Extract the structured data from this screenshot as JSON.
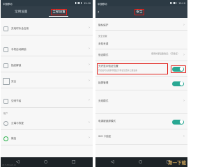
{
  "left": {
    "status": {
      "carrier": "中国移动",
      "time": "15:10"
    },
    "tabs": {
      "common": "常用设置",
      "all": "全部设置"
    },
    "rows": [
      {
        "label": "充电时补全应用"
      },
      {
        "label": "手机自动解锁"
      },
      {
        "label": "指纹解锁"
      },
      {
        "label": "安全"
      },
      {
        "label": "空闲节省"
      }
    ],
    "section": "帐户",
    "account_rows": [
      {
        "label": "云端与恢复"
      },
      {
        "label": "微信"
      }
    ],
    "credit": "@: 5.fm.sm.cn"
  },
  "right": {
    "status": {
      "carrier": "中国移动",
      "time": "15:10"
    },
    "title": "安全",
    "rows": [
      {
        "label": "隐私保护"
      },
      {
        "label": "未知来源"
      },
      {
        "label": "验证模式",
        "value": "使用外部设备验证：（已验证）"
      },
      {
        "label": "允许显示验证位置",
        "sub": "开启后可在锁屏界面显示验证位置并上报设备"
      },
      {
        "label": "锁屏管理"
      },
      {
        "label": "无线模式"
      },
      {
        "label": "电源键锁屏模式"
      },
      {
        "label": "SIM 卡锁定"
      }
    ],
    "toggle_states": [
      true,
      true,
      true
    ],
    "section": "安全设置",
    "watermark": "第一下载"
  },
  "icons": {
    "back": "back-arrow-icon",
    "chevron": "chevron-right-icon",
    "nav_back": "nav-back-icon",
    "nav_home": "nav-home-icon",
    "nav_menu": "nav-menu-icon"
  },
  "colors": {
    "toggle_on": "#29a893",
    "highlight": "#e0201a",
    "header": "#323f49"
  }
}
